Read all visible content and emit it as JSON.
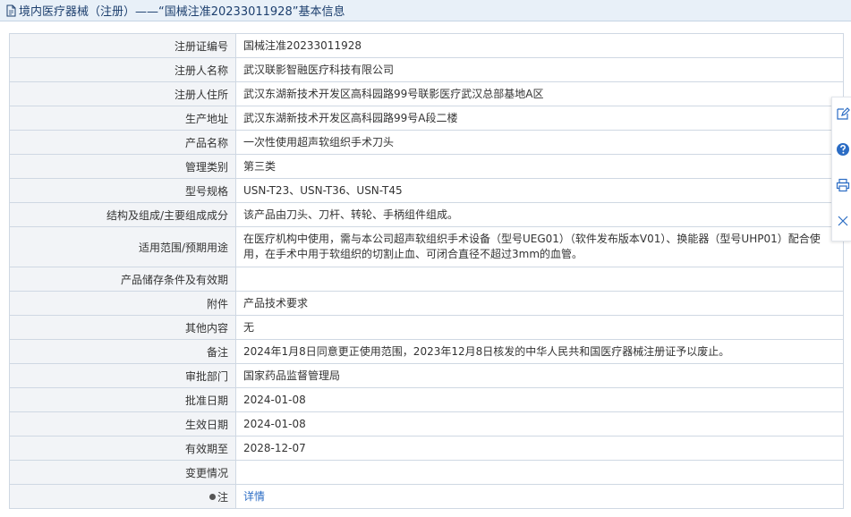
{
  "header": {
    "icon": "document-icon",
    "title": "境内医疗器械（注册）——“国械注准20233011928”基本信息"
  },
  "rows": [
    {
      "label": "注册证编号",
      "value": "国械注准20233011928"
    },
    {
      "label": "注册人名称",
      "value": "武汉联影智融医疗科技有限公司"
    },
    {
      "label": "注册人住所",
      "value": "武汉东湖新技术开发区高科园路99号联影医疗武汉总部基地A区"
    },
    {
      "label": "生产地址",
      "value": "武汉东湖新技术开发区高科园路99号A段二楼"
    },
    {
      "label": "产品名称",
      "value": "一次性使用超声软组织手术刀头"
    },
    {
      "label": "管理类别",
      "value": "第三类"
    },
    {
      "label": "型号规格",
      "value": "USN-T23、USN-T36、USN-T45"
    },
    {
      "label": "结构及组成/主要组成成分",
      "value": "该产品由刀头、刀杆、转轮、手柄组件组成。"
    },
    {
      "label": "适用范围/预期用途",
      "value": "在医疗机构中使用，需与本公司超声软组织手术设备（型号UEG01）（软件发布版本V01）、换能器（型号UHP01）配合使用，在手术中用于软组织的切割止血、可闭合直径不超过3mm的血管。"
    },
    {
      "label": "产品储存条件及有效期",
      "value": ""
    },
    {
      "label": "附件",
      "value": "产品技术要求"
    },
    {
      "label": "其他内容",
      "value": "无"
    },
    {
      "label": "备注",
      "value": "2024年1月8日同意更正使用范围，2023年12月8日核发的中华人民共和国医疗器械注册证予以废止。"
    },
    {
      "label": "审批部门",
      "value": "国家药品监督管理局"
    },
    {
      "label": "批准日期",
      "value": "2024-01-08"
    },
    {
      "label": "生效日期",
      "value": "2024-01-08"
    },
    {
      "label": "有效期至",
      "value": "2028-12-07"
    },
    {
      "label": "变更情况",
      "value": ""
    }
  ],
  "note": {
    "label": "注",
    "link_text": "详情"
  },
  "side_tools": [
    "edit-icon",
    "help-icon",
    "print-icon",
    "close-icon"
  ],
  "colors": {
    "accent": "#2b6cc4",
    "title_text": "#1d3f6e",
    "label_bg": "#f2f4f7",
    "border": "#cfd8e3"
  }
}
